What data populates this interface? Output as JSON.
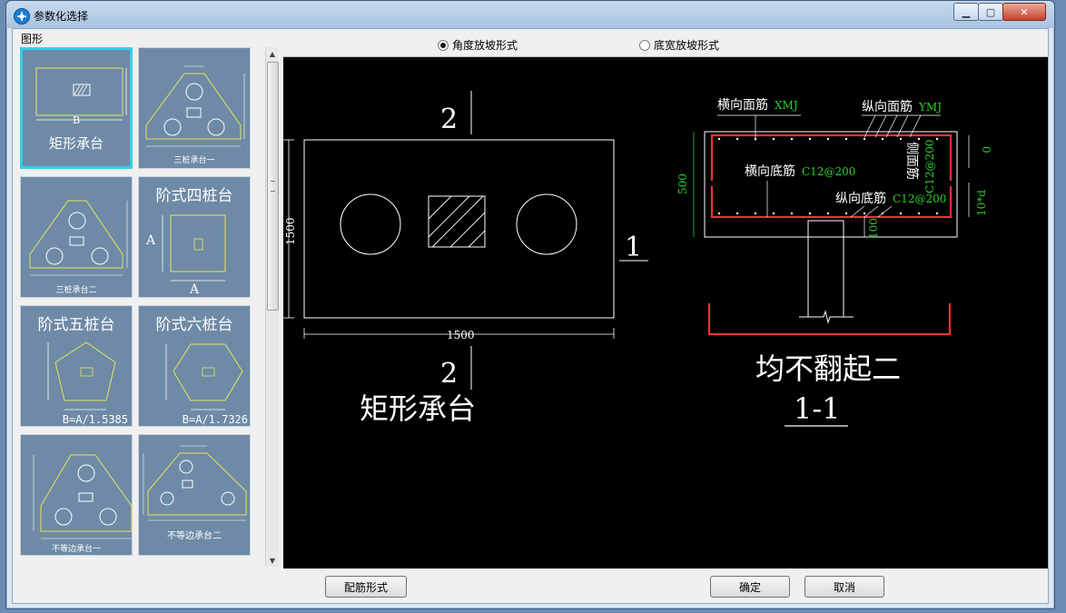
{
  "window": {
    "title": "参数化选择",
    "min_icon": "minimize-icon",
    "max_icon": "maximize-icon",
    "close_icon": "close-icon"
  },
  "left_panel": {
    "group_label": "图形",
    "thumbnails": [
      {
        "label": "矩形承台",
        "sub": "B",
        "selected": true
      },
      {
        "label": "三桩承台一"
      },
      {
        "label": "三桩承台二"
      },
      {
        "label": "阶式四桩台",
        "sub": "A"
      },
      {
        "label": "阶式五桩台",
        "sub": "B=A/1.5385"
      },
      {
        "label": "阶式六桩台",
        "sub": "B=A/1.7326"
      },
      {
        "label": "不等边承台一"
      },
      {
        "label": "不等边承台二"
      }
    ]
  },
  "options": {
    "radio1": "角度放坡形式",
    "radio2": "底宽放坡形式",
    "radio1_checked": true
  },
  "drawing": {
    "plan": {
      "section_mark_top": "2",
      "section_mark_bottom": "2",
      "section_mark_side": "1",
      "width_dim": "1500",
      "height_dim": "1500",
      "caption": "矩形承台"
    },
    "section": {
      "label_xmj": "横向面筋",
      "label_xmj_code": "XMJ",
      "label_ymj": "纵向面筋",
      "label_ymj_code": "YMJ",
      "label_bottom_x": "横向底筋",
      "label_bottom_x_val": "C12@200",
      "label_bottom_y": "纵向底筋",
      "label_bottom_y_val": "C12@200",
      "label_side": "侧面筋",
      "label_side_val": "C12@200",
      "dim_height": "500",
      "dim_top": "0",
      "dim_anchor": "10*d",
      "dim_bottom": "100",
      "caption1": "均不翻起二",
      "caption2": "1-1"
    }
  },
  "buttons": {
    "rebar_form": "配筋形式",
    "ok": "确定",
    "cancel": "取消"
  }
}
